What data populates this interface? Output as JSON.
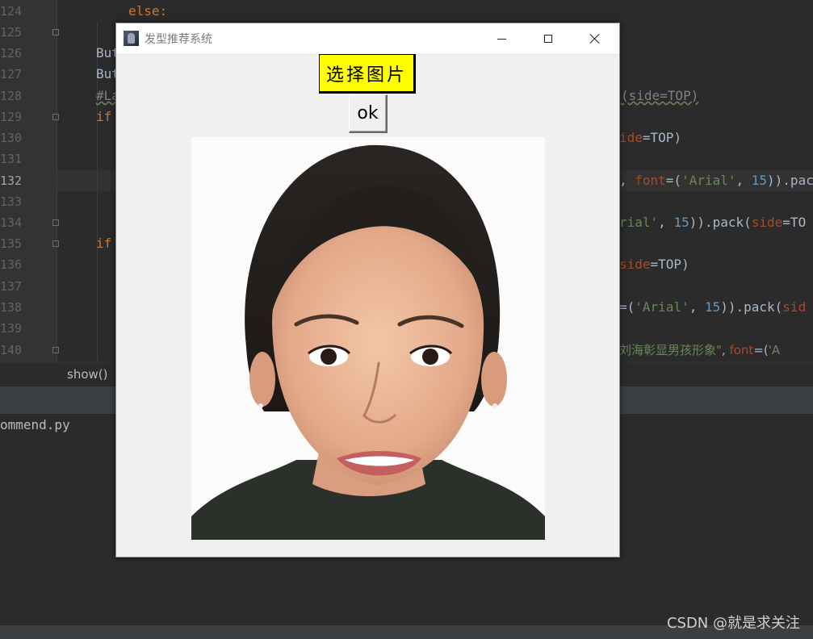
{
  "editor": {
    "line_numbers": [
      "124",
      "125",
      "126",
      "127",
      "128",
      "129",
      "130",
      "131",
      "132",
      "133",
      "134",
      "135",
      "136",
      "137",
      "138",
      "139",
      "140"
    ],
    "current_line": "132",
    "code": {
      "l124": "else:",
      "l126": "But",
      "l127": "But",
      "l128_comment": "#La",
      "l129_kw": "if",
      "l135_kw": "if",
      "r128": "(side=TOP)",
      "r130_param": "ide",
      "r130_rest": "=TOP)",
      "r132_a": ", ",
      "r132_param": "font",
      "r132_b": "=(",
      "r132_str": "'Arial'",
      "r132_c": ", ",
      "r132_num": "15",
      "r132_d": ")).pac",
      "r134_str": "rial'",
      "r134_c": ", ",
      "r134_num": "15",
      "r134_d": ")).pack(",
      "r134_param": "side",
      "r134_e": "=TO",
      "r136_param": "side",
      "r136_rest": "=TOP)",
      "r138_a": "=(",
      "r138_str": "'Arial'",
      "r138_c": ", ",
      "r138_num": "15",
      "r138_d": ")).pack(",
      "r138_param": "sid",
      "r140_str": "刘海彰显男孩形象\"",
      "r140_c": ", ",
      "r140_param": "font",
      "r140_d": "=(",
      "r140_str2": "'A"
    }
  },
  "breadcrumb": "show()",
  "console_text": "ommend.py",
  "watermark": "CSDN @就是求关注",
  "tk_window": {
    "title": "发型推荐系统",
    "select_button_label": "选择图片",
    "ok_button_label": "ok",
    "select_button_color": "#ffff00"
  },
  "colors": {
    "editor_bg": "#2b2b2b",
    "keyword": "#cc7832",
    "string": "#6a8759",
    "number": "#6897bb",
    "param": "#aa4926"
  }
}
